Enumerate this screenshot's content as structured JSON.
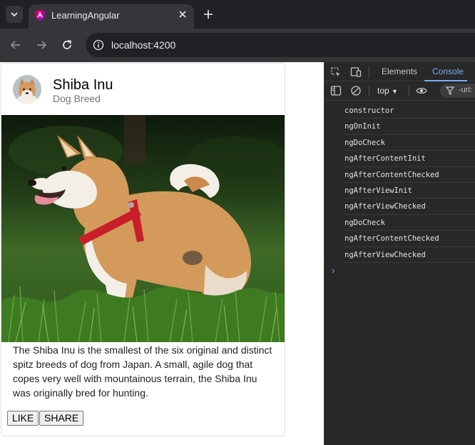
{
  "browser": {
    "tab_title": "LearningAngular",
    "url": "localhost:4200"
  },
  "card": {
    "title": "Shiba Inu",
    "subtitle": "Dog Breed",
    "text": "The Shiba Inu is the smallest of the six original and distinct spitz breeds of dog from Japan. A small, agile dog that copes very well with mountainous terrain, the Shiba Inu was originally bred for hunting.",
    "like_label": "LIKE",
    "share_label": "SHARE"
  },
  "devtools": {
    "tabs": [
      "Elements",
      "Console"
    ],
    "active_tab": "Console",
    "context": "top",
    "filter": "-url:",
    "logs": [
      "constructor",
      "ngOnInit",
      "ngDoCheck",
      "ngAfterContentInit",
      "ngAfterContentChecked",
      "ngAfterViewInit",
      "ngAfterViewChecked",
      "ngDoCheck",
      "ngAfterContentChecked",
      "ngAfterViewChecked"
    ],
    "prompt": "›"
  },
  "colors": {
    "chrome_dark": "#202124",
    "chrome_toolbar": "#35363a",
    "devtools_bg": "#282828",
    "accent_blue": "#7cacf8",
    "angular_red": "#dd0031"
  }
}
